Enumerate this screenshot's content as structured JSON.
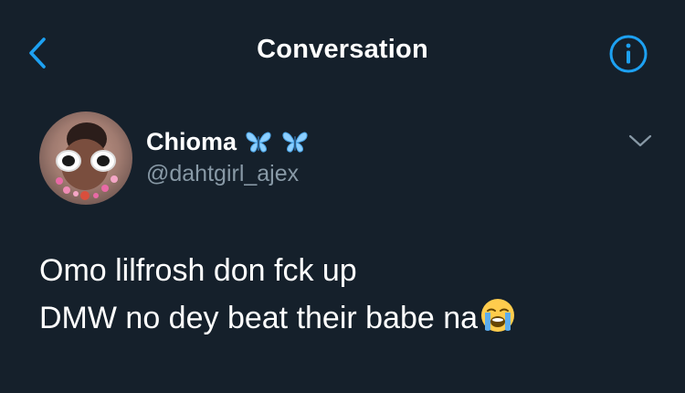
{
  "header": {
    "title": "Conversation",
    "back_icon": "chevron-left-icon",
    "info_icon": "info-icon",
    "accent_color": "#1da1f2"
  },
  "tweet": {
    "display_name": "Chioma",
    "name_emojis": [
      "butterfly-icon",
      "butterfly-icon"
    ],
    "handle": "@dahtgirl_ajex",
    "menu_icon": "chevron-down-icon",
    "lines": [
      "Omo lilfrosh don fck up",
      "DMW no dey beat their babe na"
    ],
    "trailing_emoji": "loudly-crying-face-icon"
  },
  "colors": {
    "background": "#15202b",
    "text_primary": "#ffffff",
    "text_secondary": "#8899a6"
  }
}
